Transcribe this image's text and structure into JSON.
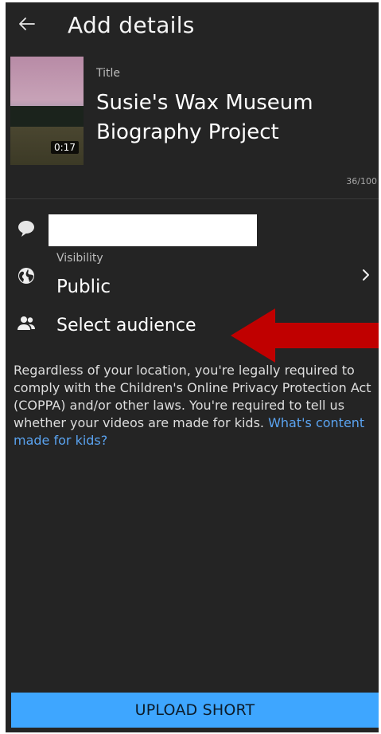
{
  "header": {
    "title": "Add details"
  },
  "video": {
    "duration": "0:17",
    "title_label": "Title",
    "title_value": "Susie's Wax Museum Biography Project",
    "char_count": "36/100"
  },
  "visibility": {
    "label": "Visibility",
    "value": "Public"
  },
  "audience": {
    "label": "Select audience"
  },
  "notice": {
    "text": "Regardless of your location, you're legally required to comply with the Children's Online Privacy Protection Act (COPPA) and/or other laws. You're required to tell us whether your videos are made for kids. ",
    "link": "What's content made for kids?"
  },
  "footer": {
    "upload_label": "UPLOAD SHORT"
  },
  "colors": {
    "background": "#242424",
    "accent": "#3ea6ff",
    "link": "#5aa3f0",
    "annotation_arrow": "#c00000"
  },
  "icons": {
    "back": "back-arrow-icon",
    "description": "comment-bubble-icon",
    "visibility": "globe-icon",
    "audience": "people-icon",
    "chevron": "chevron-right-icon"
  }
}
